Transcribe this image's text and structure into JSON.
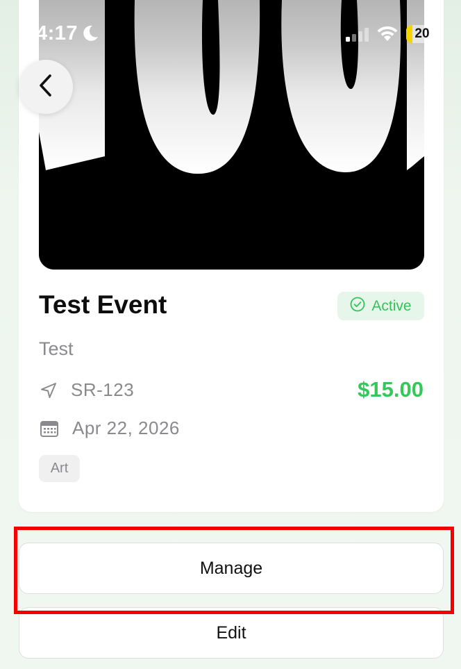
{
  "status_bar": {
    "time": "4:17",
    "battery_level": "20",
    "battery_fraction": 0.2,
    "icons": [
      "moon-icon",
      "cellular-signal-icon",
      "wifi-icon",
      "battery-icon"
    ]
  },
  "nav": {
    "back_icon": "chevron-left-icon"
  },
  "event": {
    "title": "Test Event",
    "status": "Active",
    "status_icon": "check-circle-icon",
    "description": "Test",
    "location": "SR-123",
    "location_icon": "location-arrow-icon",
    "price": "$15.00",
    "date": "Apr 22, 2026",
    "date_icon": "calendar-icon",
    "tags": [
      "Art"
    ]
  },
  "actions": {
    "manage_label": "Manage",
    "edit_label": "Edit"
  },
  "colors": {
    "accent_green": "#34c759",
    "badge_bg": "#e6f6ea",
    "highlight_red": "#f40000"
  }
}
